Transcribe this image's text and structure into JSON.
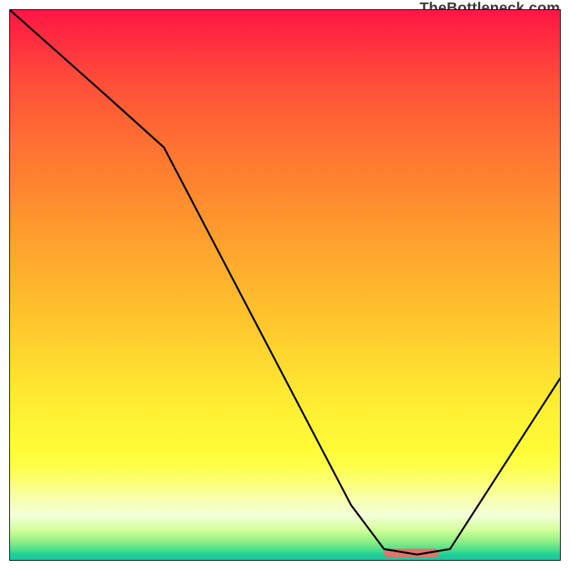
{
  "watermark": "TheBottleneck.com",
  "chart_data": {
    "type": "line",
    "title": "",
    "xlabel": "",
    "ylabel": "",
    "xlim": [
      0,
      100
    ],
    "ylim": [
      0,
      100
    ],
    "grid": false,
    "series": [
      {
        "name": "curve",
        "x": [
          0,
          18,
          28,
          62,
          68,
          74,
          80,
          100
        ],
        "values": [
          100,
          84,
          75,
          10,
          2,
          1,
          2,
          33
        ]
      }
    ],
    "markers": [
      {
        "name": "bottleneck-marker",
        "x_range": [
          68,
          78
        ],
        "y": 1.3,
        "color": "#e2736b"
      }
    ],
    "background": {
      "type": "vertical-gradient",
      "stops": [
        {
          "pos": 0.0,
          "color": "#ff1744"
        },
        {
          "pos": 0.5,
          "color": "#ffb82e"
        },
        {
          "pos": 0.8,
          "color": "#fffb37"
        },
        {
          "pos": 0.92,
          "color": "#f2ffd8"
        },
        {
          "pos": 1.0,
          "color": "#18c89e"
        }
      ]
    }
  }
}
